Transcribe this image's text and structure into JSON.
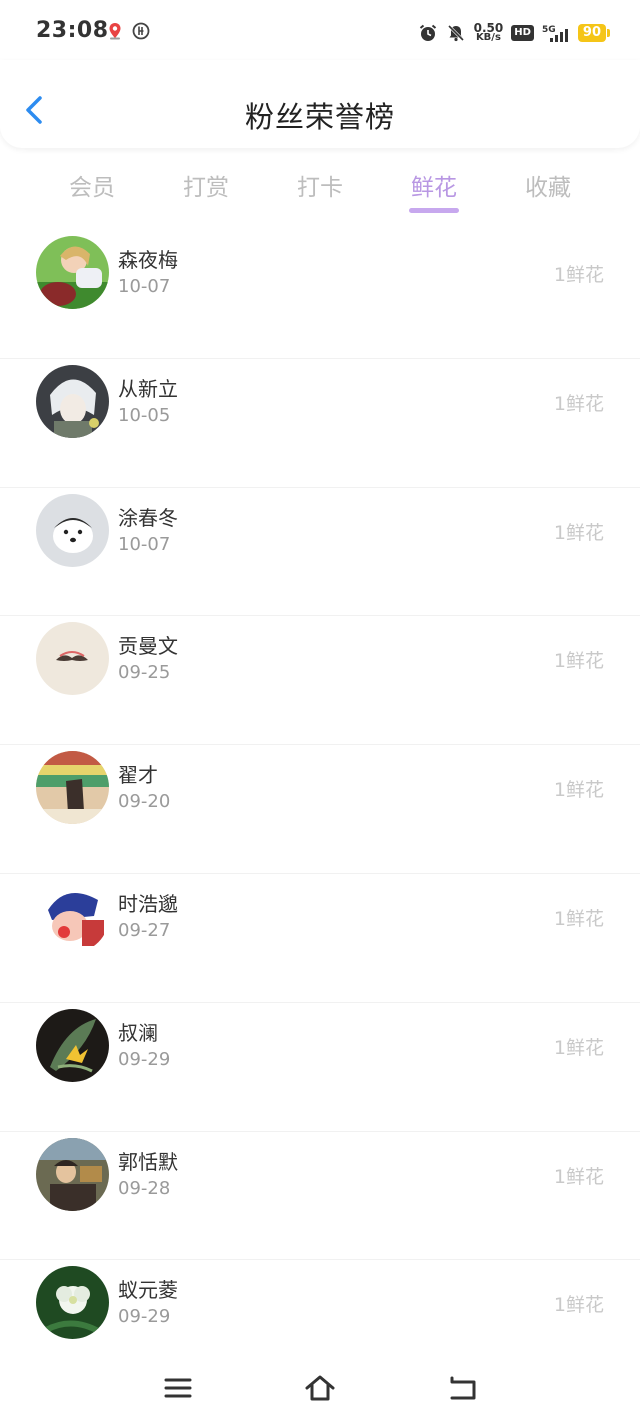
{
  "status_bar": {
    "time": "23:08",
    "net_speed_value": "0.50",
    "net_speed_unit": "KB/s",
    "hd_label": "HD",
    "signal_label": "5G",
    "battery": "90",
    "battery_color": "#f5c518"
  },
  "header": {
    "title": "粉丝荣誉榜",
    "back_icon": "chevron-left-icon",
    "accent_color": "#2d8cf0"
  },
  "tabs": {
    "items": [
      {
        "label": "会员"
      },
      {
        "label": "打赏"
      },
      {
        "label": "打卡"
      },
      {
        "label": "鲜花",
        "active": true
      },
      {
        "label": "收藏"
      }
    ],
    "active_color": "#b897e3"
  },
  "list": {
    "rows": [
      {
        "name": "森夜梅",
        "date": "10-07",
        "amount": "1鲜花"
      },
      {
        "name": "从新立",
        "date": "10-05",
        "amount": "1鲜花"
      },
      {
        "name": "涂春冬",
        "date": "10-07",
        "amount": "1鲜花"
      },
      {
        "name": "贡曼文",
        "date": "09-25",
        "amount": "1鲜花"
      },
      {
        "name": "翟才",
        "date": "09-20",
        "amount": "1鲜花"
      },
      {
        "name": "时浩邈",
        "date": "09-27",
        "amount": "1鲜花"
      },
      {
        "name": "叔澜",
        "date": "09-29",
        "amount": "1鲜花"
      },
      {
        "name": "郭恬默",
        "date": "09-28",
        "amount": "1鲜花"
      },
      {
        "name": "蚁元菱",
        "date": "09-29",
        "amount": "1鲜花"
      }
    ]
  },
  "nav_bar": {
    "menu_icon": "menu-icon",
    "home_icon": "home-icon",
    "back_icon": "back-icon"
  }
}
